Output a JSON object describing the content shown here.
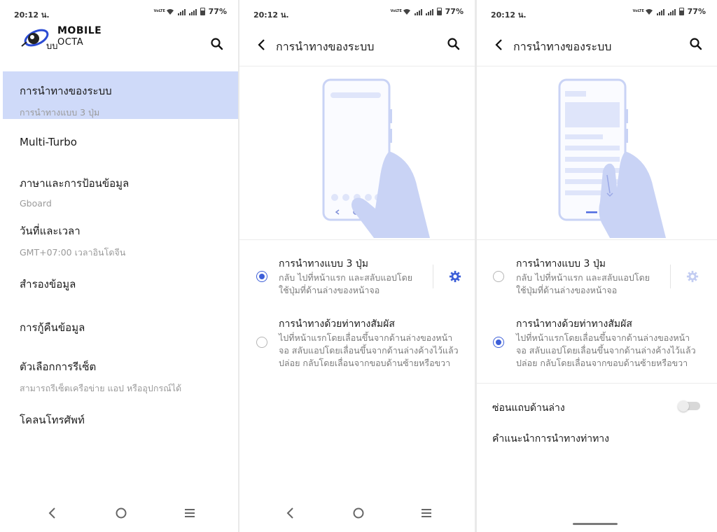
{
  "status": {
    "time": "20:12 น.",
    "lte": "VoLTE",
    "battery": "77%"
  },
  "screen1": {
    "logo": {
      "line1": "MOBILE",
      "line2": "OCTA",
      "prefix": "บบ"
    },
    "menu": [
      {
        "title": "การนำทางของระบบ",
        "subtitle": "การนำทางแบบ 3 ปุ่ม",
        "selected": true
      },
      {
        "title": "Multi-Turbo",
        "subtitle": ""
      },
      {
        "title": "ภาษาและการป้อนข้อมูล",
        "subtitle": "Gboard"
      },
      {
        "title": "วันที่และเวลา",
        "subtitle": "GMT+07:00 เวลาอินโดจีน"
      },
      {
        "title": "สำรองข้อมูล",
        "subtitle": ""
      },
      {
        "title": "การกู้คืนข้อมูล",
        "subtitle": ""
      },
      {
        "title": "ตัวเลือกการรีเซ็ต",
        "subtitle": "สามารถรีเซ็ตเครือข่าย แอป หรืออุปกรณ์ได้"
      },
      {
        "title": "โคลนโทรศัพท์",
        "subtitle": ""
      }
    ]
  },
  "screen2": {
    "title": "การนำทางของระบบ",
    "options": [
      {
        "title": "การนำทางแบบ 3 ปุ่ม",
        "desc": [
          "กลับ ไปที่หน้าแรก และสลับแอปโดย",
          "ใช้ปุ่มที่ด้านล่างของหน้าจอ"
        ],
        "selected": true
      },
      {
        "title": "การนำทางด้วยท่าทางสัมผัส",
        "desc": [
          "ไปที่หน้าแรกโดยเลื่อนขึ้นจากด้านล่างของหน้า",
          "จอ สลับแอปโดยเลื่อนขึ้นจากด้านล่างค้างไว้แล้ว",
          "ปล่อย กลับโดยเลื่อนจากขอบด้านซ้ายหรือขวา"
        ],
        "selected": false
      }
    ]
  },
  "screen3": {
    "title": "การนำทางของระบบ",
    "options": [
      {
        "title": "การนำทางแบบ 3 ปุ่ม",
        "desc": [
          "กลับ ไปที่หน้าแรก และสลับแอปโดย",
          "ใช้ปุ่มที่ด้านล่างของหน้าจอ"
        ],
        "selected": false
      },
      {
        "title": "การนำทางด้วยท่าทางสัมผัส",
        "desc": [
          "ไปที่หน้าแรกโดยเลื่อนขึ้นจากด้านล่างของหน้า",
          "จอ สลับแอปโดยเลื่อนขึ้นจากด้านล่างค้างไว้แล้ว",
          "ปล่อย กลับโดยเลื่อนจากขอบด้านซ้ายหรือขวา"
        ],
        "selected": true
      }
    ],
    "hide_bar_label": "ซ่อนแถบด้านล่าง",
    "hide_bar_on": false,
    "gesture_tips_label": "คำแนะนำการนำทางท่าทาง"
  },
  "colors": {
    "accent": "#3d5fd8",
    "selected_bg": "#cfdaf9",
    "illustration": "#c9d3f5"
  },
  "icons": [
    "back-arrow-icon",
    "search-icon",
    "gear-icon",
    "nav-back-icon",
    "nav-home-icon",
    "nav-menu-icon",
    "radio-icon"
  ]
}
